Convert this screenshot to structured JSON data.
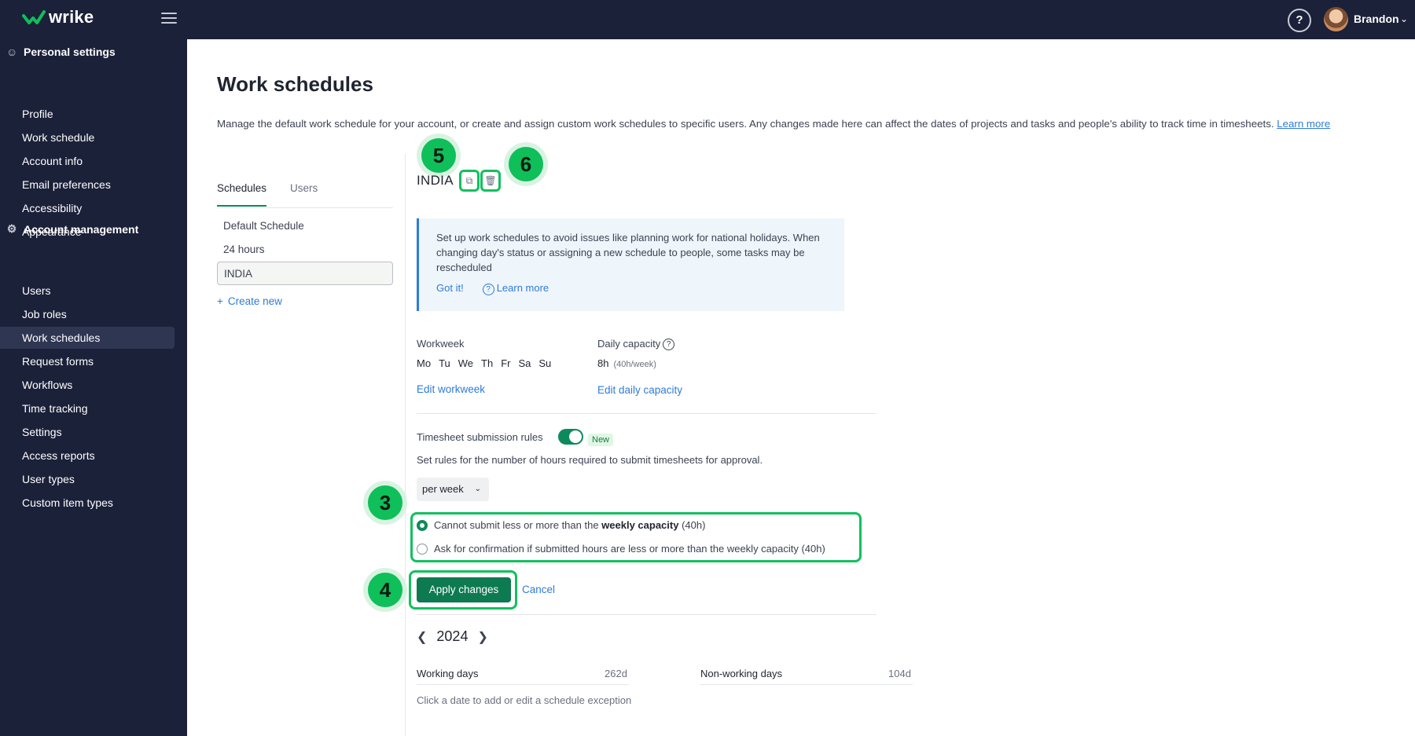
{
  "app": {
    "logo_text": "wrike",
    "user_name": "Brandon",
    "help_symbol": "?"
  },
  "sidebar": {
    "personal_section": "Personal settings",
    "personal_items": [
      "Profile",
      "Work schedule",
      "Account info",
      "Email preferences",
      "Accessibility",
      "Appearance"
    ],
    "account_section": "Account management",
    "account_items": [
      "Users",
      "Job roles",
      "Work schedules",
      "Request forms",
      "Workflows",
      "Time tracking",
      "Settings",
      "Access reports",
      "User types",
      "Custom item types"
    ],
    "active_item": "Work schedules"
  },
  "page": {
    "title": "Work schedules",
    "description": "Manage the default work schedule for your account, or create and assign custom work schedules to specific users. Any changes made here can affect the dates of projects and tasks and people's ability to track time in timesheets.",
    "learn_more": "Learn more"
  },
  "tabs": [
    "Schedules",
    "Users"
  ],
  "schedules": [
    "Default Schedule",
    "24 hours",
    "INDIA"
  ],
  "create_new": "Create new",
  "schedule": {
    "name": "INDIA",
    "info_text": "Set up work schedules to avoid issues like planning work for national holidays. When changing day's status or assigning a new schedule to people, some tasks may be rescheduled",
    "got_it": "Got it!",
    "info_learn_more": "Learn more",
    "workweek_label": "Workweek",
    "days": [
      "Mo",
      "Tu",
      "We",
      "Th",
      "Fr",
      "Sa",
      "Su"
    ],
    "edit_workweek": "Edit workweek",
    "capacity_label": "Daily capacity",
    "capacity_value": "8h",
    "capacity_week": "(40h/week)",
    "edit_capacity": "Edit daily capacity",
    "timesheet_label": "Timesheet submission rules",
    "timesheet_enabled": true,
    "new_tag": "New",
    "timesheet_desc": "Set rules for the number of hours required to submit timesheets for approval.",
    "period": "per week",
    "rule_1_prefix": "Cannot submit less or more than the ",
    "rule_1_bold": "weekly capacity",
    "rule_1_suffix": " (40h)",
    "rule_2": "Ask for confirmation if submitted hours are less or more than the weekly capacity (40h)",
    "selected_rule": 1,
    "apply": "Apply changes",
    "cancel": "Cancel",
    "year": "2024",
    "working_days_label": "Working days",
    "working_days": "262d",
    "nonworking_days_label": "Non-working days",
    "nonworking_days": "104d",
    "hint": "Click a date to add or edit a schedule exception"
  },
  "callouts": [
    "5",
    "6",
    "3",
    "4"
  ],
  "colors": {
    "nav_bg": "#1b2139",
    "accent_green": "#0d8a5c",
    "highlight_green": "#12c05e",
    "link_blue": "#2f7cd6"
  }
}
